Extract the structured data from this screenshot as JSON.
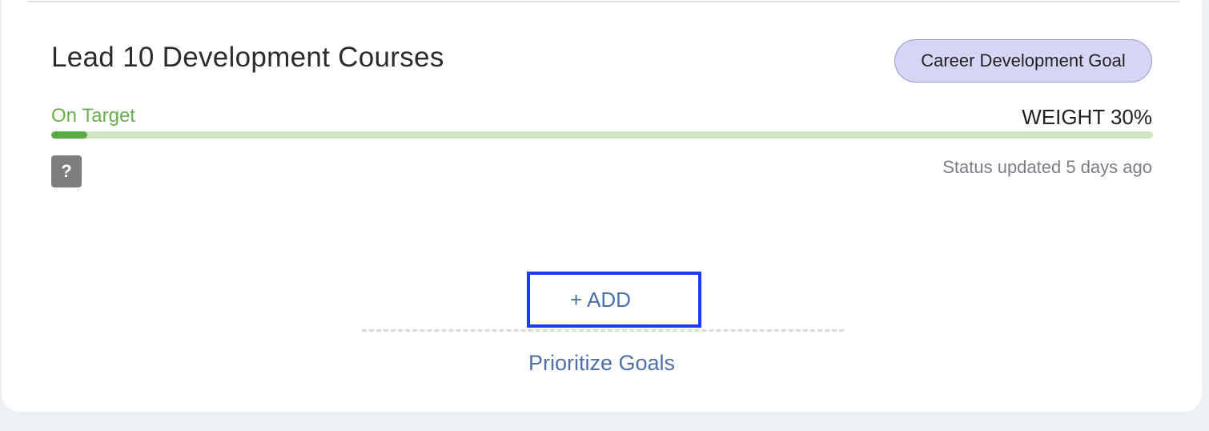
{
  "goal": {
    "title": "Lead 10 Development Courses",
    "type_badge": "Career Development Goal",
    "status": "On Target",
    "weight": "WEIGHT 30%",
    "progress_fraction": 0.033,
    "status_updated": "Status updated 5 days ago",
    "help_label": "?"
  },
  "actions": {
    "add_label": "+ ADD",
    "prioritize_label": "Prioritize Goals"
  },
  "colors": {
    "status_green": "#6ab04c",
    "progress_fill": "#5aaa44",
    "progress_track": "#cfe6c3",
    "badge_bg": "#d6d5f6",
    "badge_border": "#9a97dc",
    "link_blue": "#4d6faa",
    "focus_outline": "#1f3cf0"
  }
}
